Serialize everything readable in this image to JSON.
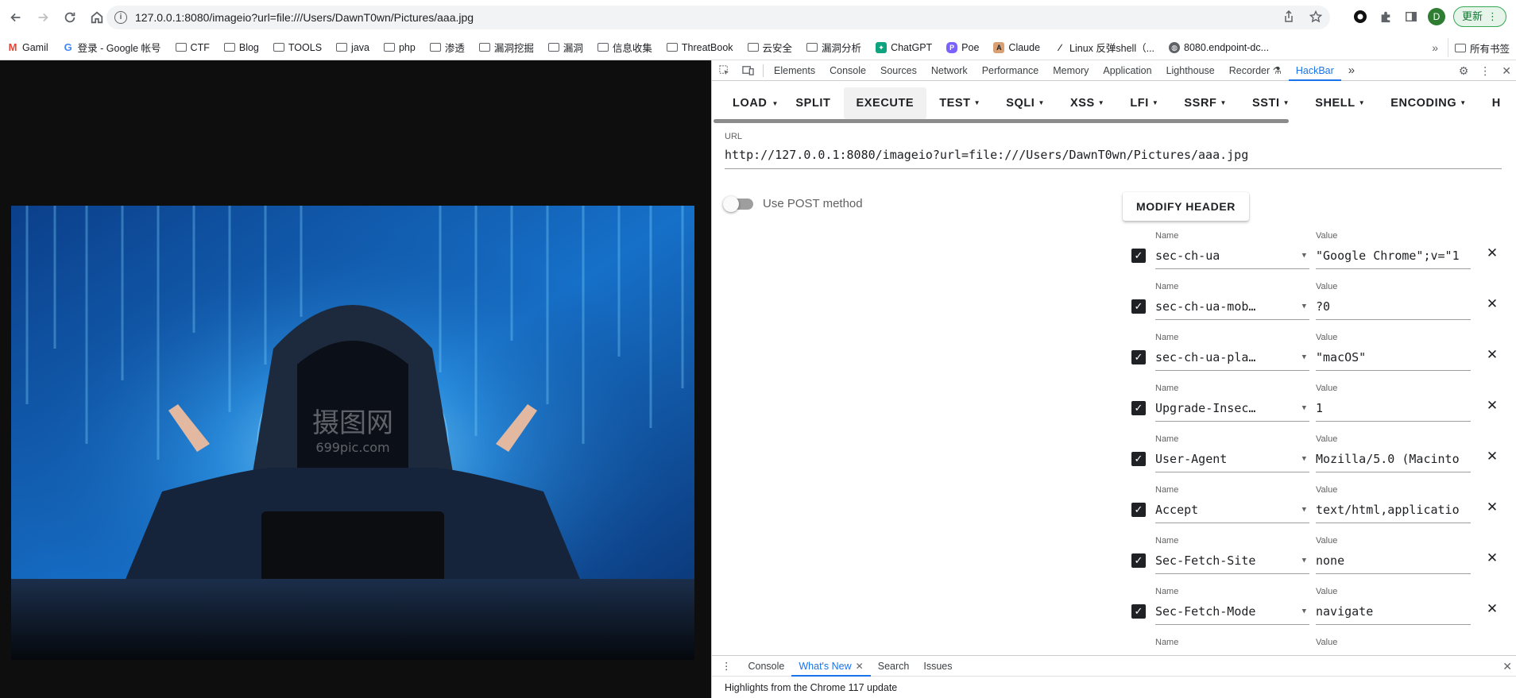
{
  "browser": {
    "url": "127.0.0.1:8080/imageio?url=file:///Users/DawnT0wn/Pictures/aaa.jpg",
    "avatar_letter": "D",
    "update_label": "更新",
    "colors": {
      "update_bg": "#e6f4ea",
      "update_text": "#137333",
      "avatar": "#2e7d32"
    }
  },
  "bookmarks": {
    "items": [
      {
        "label": "Gamil",
        "icon": "gmail-icon"
      },
      {
        "label": "登录 - Google 帐号",
        "icon": "google-icon"
      },
      {
        "label": "CTF",
        "icon": "folder-icon"
      },
      {
        "label": "Blog",
        "icon": "folder-icon"
      },
      {
        "label": "TOOLS",
        "icon": "folder-icon"
      },
      {
        "label": "java",
        "icon": "folder-icon"
      },
      {
        "label": "php",
        "icon": "folder-icon"
      },
      {
        "label": "渗透",
        "icon": "folder-icon"
      },
      {
        "label": "漏洞挖掘",
        "icon": "folder-icon"
      },
      {
        "label": "漏洞",
        "icon": "folder-icon"
      },
      {
        "label": "信息收集",
        "icon": "folder-icon"
      },
      {
        "label": "ThreatBook",
        "icon": "folder-icon"
      },
      {
        "label": "云安全",
        "icon": "folder-icon"
      },
      {
        "label": "漏洞分析",
        "icon": "folder-icon"
      },
      {
        "label": "ChatGPT",
        "icon": "chatgpt-icon"
      },
      {
        "label": "Poe",
        "icon": "poe-icon"
      },
      {
        "label": "Claude",
        "icon": "claude-icon"
      },
      {
        "label": "Linux 反弹shell（...",
        "icon": "linux-icon"
      },
      {
        "label": "8080.endpoint-dc...",
        "icon": "globe-icon"
      }
    ],
    "more": "»",
    "all_label": "所有书签"
  },
  "devtools": {
    "tabs": [
      "Elements",
      "Console",
      "Sources",
      "Network",
      "Performance",
      "Memory",
      "Application",
      "Lighthouse",
      "Recorder",
      "HackBar"
    ],
    "active_tab": "HackBar",
    "overflow": "»"
  },
  "hackbar": {
    "buttons": [
      "LOAD",
      "SPLIT",
      "EXECUTE",
      "TEST",
      "SQLI",
      "XSS",
      "LFI",
      "SSRF",
      "SSTI",
      "SHELL",
      "ENCODING",
      "H"
    ],
    "url_label": "URL",
    "url_value": "http://127.0.0.1:8080/imageio?url=file:///Users/DawnT0wn/Pictures/aaa.jpg",
    "post_label": "Use POST method",
    "post_enabled": false,
    "modify_header_label": "MODIFY HEADER",
    "name_label": "Name",
    "value_label": "Value",
    "headers": [
      {
        "name": "sec-ch-ua",
        "value": "\"Google Chrome\";v=\"1"
      },
      {
        "name": "sec-ch-ua-mob…",
        "value": "?0"
      },
      {
        "name": "sec-ch-ua-pla…",
        "value": "\"macOS\""
      },
      {
        "name": "Upgrade-Insec…",
        "value": "1"
      },
      {
        "name": "User-Agent",
        "value": "Mozilla/5.0 (Macinto"
      },
      {
        "name": "Accept",
        "value": "text/html,applicatio"
      },
      {
        "name": "Sec-Fetch-Site",
        "value": "none"
      },
      {
        "name": "Sec-Fetch-Mode",
        "value": "navigate"
      }
    ],
    "partial_name_label": "Name",
    "partial_value_label": "Value"
  },
  "drawer": {
    "tabs": [
      "Console",
      "What's New",
      "Search",
      "Issues"
    ],
    "active_tab": "What's New",
    "message": "Highlights from the Chrome 117 update"
  },
  "image": {
    "watermark_cn": "摄图网",
    "watermark_url": "699pic.com"
  }
}
